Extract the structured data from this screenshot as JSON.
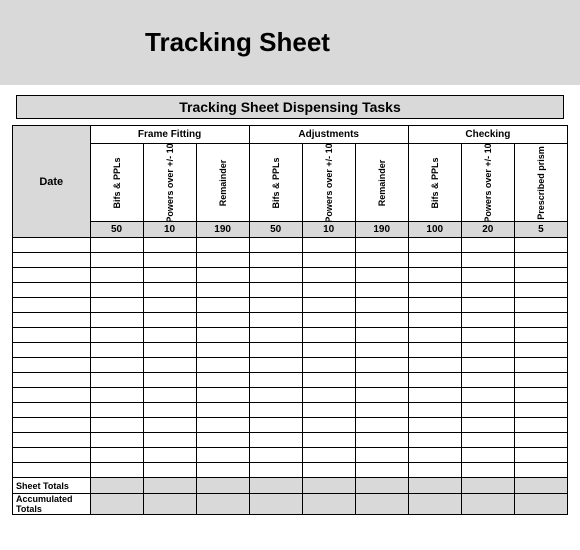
{
  "header": {
    "title": "Tracking Sheet"
  },
  "subtitle": "Tracking Sheet Dispensing Tasks",
  "columns": {
    "date_label": "Date",
    "groups": [
      {
        "name": "Frame Fitting"
      },
      {
        "name": "Adjustments"
      },
      {
        "name": "Checking"
      }
    ],
    "tasks": [
      {
        "label": "Bifs & PPLs",
        "target": "50"
      },
      {
        "label": "Powers over +/- 10",
        "target": "10"
      },
      {
        "label": "Remainder",
        "target": "190"
      },
      {
        "label": "Bifs & PPLs",
        "target": "50"
      },
      {
        "label": "Powers over +/- 10",
        "target": "10"
      },
      {
        "label": "Remainder",
        "target": "190"
      },
      {
        "label": "Bifs & PPLs",
        "target": "100"
      },
      {
        "label": "Powers over +/- 10",
        "target": "20"
      },
      {
        "label": "Prescribed prism",
        "target": "5"
      }
    ]
  },
  "footer": {
    "sheet_totals_label": "Sheet Totals",
    "accumulated_totals_label": "Accumulated Totals"
  }
}
